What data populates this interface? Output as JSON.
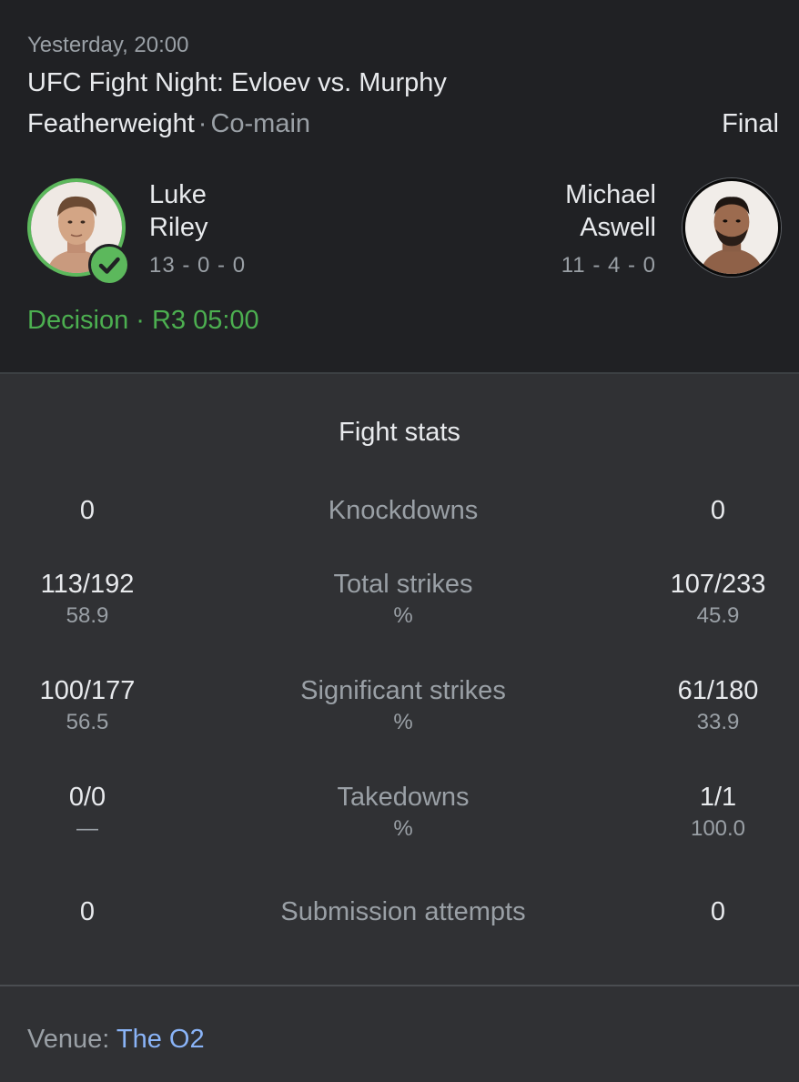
{
  "header": {
    "timestamp": "Yesterday, 20:00",
    "event": "UFC Fight Night: Evloev vs. Murphy",
    "weight_class": "Featherweight",
    "separator": "·",
    "card_position": "Co-main",
    "status": "Final"
  },
  "fighters": {
    "left": {
      "first": "Luke",
      "last": "Riley",
      "record": "13 - 0 - 0",
      "winner": true,
      "avatar_icon": "fighter-photo"
    },
    "right": {
      "first": "Michael",
      "last": "Aswell",
      "record": "11 - 4 - 0",
      "winner": false,
      "avatar_icon": "fighter-photo"
    }
  },
  "result": "Decision · R3 05:00",
  "stats": {
    "title": "Fight stats",
    "rows": [
      {
        "label": "Knockdowns",
        "left": "0",
        "right": "0"
      },
      {
        "label": "Total strikes",
        "left": "113/192",
        "right": "107/233",
        "sub_label": "%",
        "left_sub": "58.9",
        "right_sub": "45.9"
      },
      {
        "label": "Significant strikes",
        "left": "100/177",
        "right": "61/180",
        "sub_label": "%",
        "left_sub": "56.5",
        "right_sub": "33.9"
      },
      {
        "label": "Takedowns",
        "left": "0/0",
        "right": "1/1",
        "sub_label": "%",
        "left_sub": "—",
        "right_sub": "100.0"
      },
      {
        "label": "Submission attempts",
        "left": "0",
        "right": "0"
      }
    ]
  },
  "venue": {
    "label": "Venue:",
    "name": "The O2"
  },
  "colors": {
    "win_green": "#5cb85c",
    "link_blue": "#8ab4f8",
    "background": "#303134",
    "header_bg": "#202124"
  }
}
